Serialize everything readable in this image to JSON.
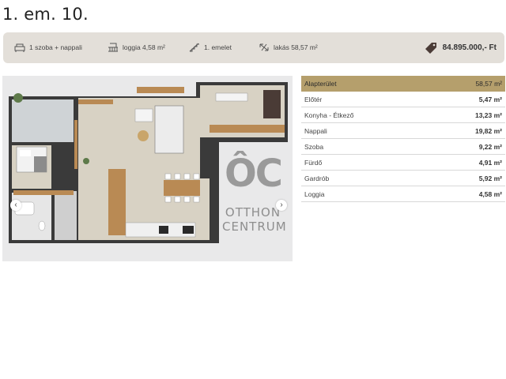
{
  "title": "1. em. 10.",
  "info": {
    "rooms": "1 szoba + nappali",
    "loggia": "loggia 4,58 m²",
    "floor": "1. emelet",
    "area": "lakás 58,57 m²",
    "price": "84.895.000,- Ft"
  },
  "floorplan": {
    "logo_letters": "ÔC",
    "logo_line1": "OTTHON",
    "logo_line2": "CENTRUM",
    "prev_label": "‹",
    "next_label": "›"
  },
  "areas": {
    "header": {
      "label": "Alapterület",
      "value": "58,57 m²"
    },
    "rows": [
      {
        "label": "Előtér",
        "value": "5,47 m²"
      },
      {
        "label": "Konyha - Étkező",
        "value": "13,23 m²"
      },
      {
        "label": "Nappali",
        "value": "19,82 m²"
      },
      {
        "label": "Szoba",
        "value": "9,22 m²"
      },
      {
        "label": "Fürdő",
        "value": "4,91 m²"
      },
      {
        "label": "Gardrób",
        "value": "5,92 m²"
      },
      {
        "label": "Loggia",
        "value": "4,58 m²"
      }
    ]
  },
  "colors": {
    "info_bar": "#e3dfd9",
    "table_header": "#b59f6c",
    "plan_background": "#e9e9ea"
  }
}
